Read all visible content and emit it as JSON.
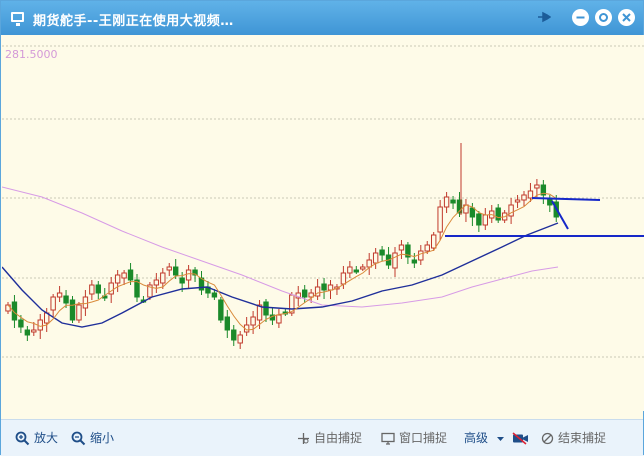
{
  "window": {
    "title": "期货舵手--王刚正在使用大视频…"
  },
  "chart": {
    "price_label": "281.5000",
    "colors": {
      "up": "#c0392b",
      "down": "#1a8a2a",
      "ma_short": "#d98a3a",
      "ma_mid": "#1f2f9a",
      "ma_long": "#d79be6",
      "annotation": "#1628c8",
      "grid": "#c9c9b6",
      "background": "#fefbe8"
    }
  },
  "toolbar": {
    "zoom_in": "放大",
    "zoom_out": "缩小",
    "free_capture": "自由捕捉",
    "window_capture": "窗口捕捉",
    "advanced": "高级",
    "end_capture": "结束捕捉"
  }
}
